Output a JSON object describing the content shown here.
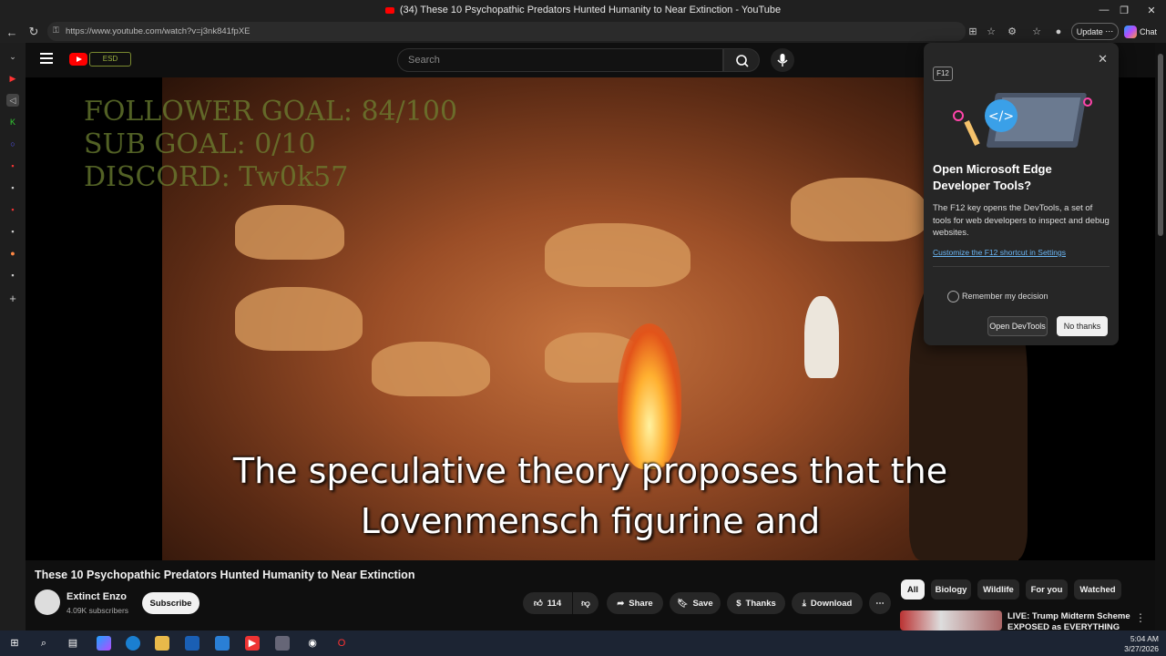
{
  "window": {
    "title": "(34) These 10 Psychopathic Predators Hunted Humanity to Near Extinction - YouTube"
  },
  "browser": {
    "url": "https://www.youtube.com/watch?v=j3nk841fpXE",
    "update_label": "Update",
    "chat_label": "Chat"
  },
  "youtube": {
    "search_placeholder": "Search",
    "channel_logo_text": "ESD"
  },
  "video": {
    "overlay_lines": [
      "FOLLOWER GOAL: 84/100",
      "SUB GOAL: 0/10",
      "DISCORD: Tw0k57"
    ],
    "subtitle_line1": "The speculative theory proposes that the",
    "subtitle_line2": "Lovenmensch figurine and"
  },
  "devtools_popup": {
    "badge": "F12",
    "title": "Open Microsoft Edge Developer Tools?",
    "description": "The F12 key opens the DevTools, a set of tools for web developers to inspect and debug websites.",
    "link": "Customize the F12 shortcut in Settings",
    "remember_label": "Remember my decision",
    "open_button": "Open DevTools",
    "no_thanks_button": "No thanks"
  },
  "video_info": {
    "title": "These 10 Psychopathic Predators Hunted Humanity to Near Extinction",
    "channel_name": "Extinct Enzo",
    "subscribers": "4.09K subscribers",
    "subscribe_label": "Subscribe",
    "like_count": "114",
    "share_label": "Share",
    "save_label": "Save",
    "thanks_label": "Thanks",
    "download_label": "Download"
  },
  "chips": [
    "All",
    "Biology",
    "Wildlife",
    "For you",
    "Watched"
  ],
  "recommendation": {
    "title": "LIVE: Trump Midterm Scheme EXPOSED as EVERYTHING"
  },
  "taskbar": {
    "time": "5:04 AM",
    "date": "3/27/2026"
  },
  "colors": {
    "youtube_red": "#ff0000",
    "edge_link": "#6ab6f5"
  }
}
